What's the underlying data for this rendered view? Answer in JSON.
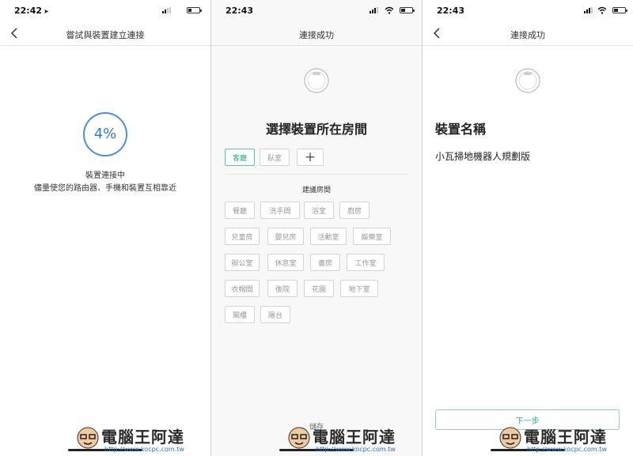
{
  "panel1": {
    "status": {
      "time": "22:42",
      "location_icon": "location-arrow-icon"
    },
    "nav": {
      "title": "嘗試與裝置建立連接",
      "back_icon": "chevron-left-icon"
    },
    "progress": {
      "percent_text": "4%",
      "percent": 4
    },
    "status_message": "裝置連接中",
    "hint_message": "儘量使您的路由器、手機和裝置互相靠近"
  },
  "panel2": {
    "status": {
      "time": "22:43"
    },
    "nav": {
      "title": "連接成功"
    },
    "heading": "選擇裝置所在房間",
    "selected_rooms": [
      {
        "label": "客廳",
        "selected": true
      },
      {
        "label": "臥室",
        "selected": false
      }
    ],
    "add_label": "+",
    "suggest_label": "建議房間",
    "suggested_rooms": [
      [
        "餐廳",
        "洗手間",
        "浴室",
        "廚房"
      ],
      [
        "兒童房",
        "嬰兒房",
        "活動室",
        "娛樂室"
      ],
      [
        "辦公室",
        "休息室",
        "書房",
        "工作室"
      ],
      [
        "衣帽間",
        "後院",
        "花園",
        "地下室"
      ],
      [
        "閣樓",
        "陽台"
      ]
    ],
    "save_label": "儲存"
  },
  "panel3": {
    "status": {
      "time": "22:43"
    },
    "nav": {
      "title": "連接成功",
      "back_icon": "chevron-left-icon"
    },
    "heading": "裝置名稱",
    "device_name": "小瓦掃地機器人規劃版",
    "next_label": "下一步"
  },
  "watermark": {
    "brand": "電腦王阿達",
    "url": "http://www.kocpc.com.tw"
  },
  "colors": {
    "accent_blue": "#2e7cd1",
    "accent_green": "#27a979",
    "chip_border": "#d3d3d3"
  }
}
